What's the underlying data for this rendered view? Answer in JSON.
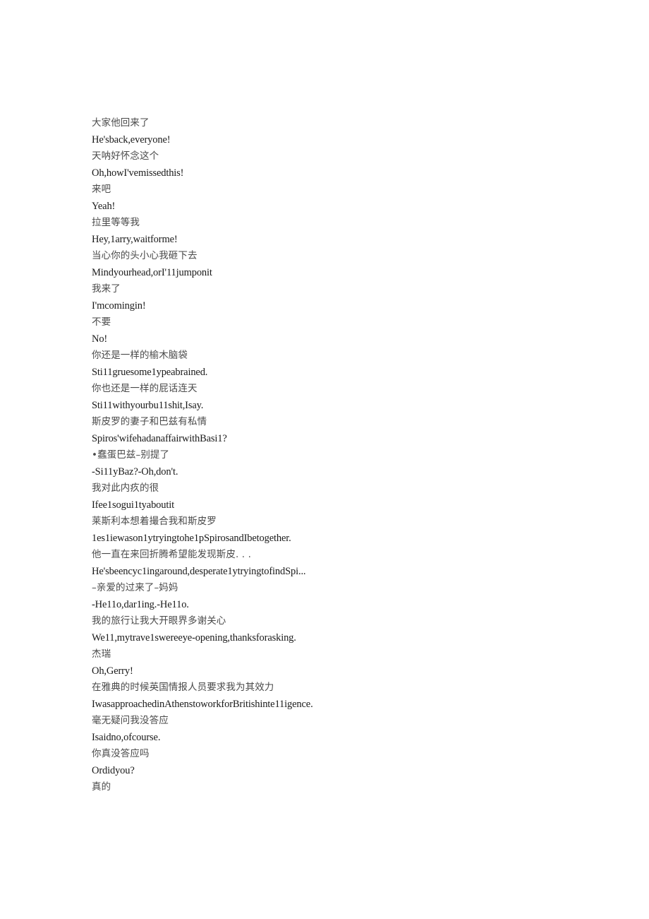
{
  "document": {
    "background_color": "#ffffff",
    "zh_text_color": "#4a4a4a",
    "en_text_color": "#1a1a1a",
    "lines": [
      {
        "lang": "zh",
        "text": "大家他回来了"
      },
      {
        "lang": "en",
        "text": "He'sback,everyone!"
      },
      {
        "lang": "zh",
        "text": "天呐好怀念这个"
      },
      {
        "lang": "en",
        "text": "Oh,howI'vemissedthis!"
      },
      {
        "lang": "zh",
        "text": "来吧"
      },
      {
        "lang": "en",
        "text": "Yeah!"
      },
      {
        "lang": "zh",
        "text": "拉里等等我"
      },
      {
        "lang": "en",
        "text": "Hey,1arry,waitforme!"
      },
      {
        "lang": "zh",
        "text": "当心你的头小心我砸下去"
      },
      {
        "lang": "en",
        "text": "Mindyourhead,orI'11jumponit"
      },
      {
        "lang": "zh",
        "text": "我来了"
      },
      {
        "lang": "en",
        "text": "I'mcomingin!"
      },
      {
        "lang": "zh",
        "text": "不要"
      },
      {
        "lang": "en",
        "text": "No!"
      },
      {
        "lang": "zh",
        "text": "你还是一样的榆木脑袋"
      },
      {
        "lang": "en",
        "text": "Sti11gruesome1ypeabrained."
      },
      {
        "lang": "zh",
        "text": "你也还是一样的屁话连天"
      },
      {
        "lang": "en",
        "text": "Sti11withyourbu11shit,Isay."
      },
      {
        "lang": "zh",
        "text": "斯皮罗的妻子和巴兹有私情"
      },
      {
        "lang": "en",
        "text": "Spiros'wifehadanaffairwithBasi1?"
      },
      {
        "lang": "zh",
        "text": "•蠢蛋巴兹–别提了"
      },
      {
        "lang": "en",
        "text": "-Si11yBaz?-Oh,don't."
      },
      {
        "lang": "zh",
        "text": "我对此内疚的很"
      },
      {
        "lang": "en",
        "text": "Ifee1sogui1tyaboutit"
      },
      {
        "lang": "zh",
        "text": "莱斯利本想着撮合我和斯皮罗"
      },
      {
        "lang": "en",
        "text": "1es1iewason1ytryingtohe1pSpirosandIbetogether."
      },
      {
        "lang": "zh",
        "text": "他一直在来回折腾希望能发现斯皮. . ."
      },
      {
        "lang": "en",
        "text": "He'sbeencyc1ingaround,desperate1ytryingtofindSpi..."
      },
      {
        "lang": "zh",
        "text": "–亲爱的过来了–妈妈"
      },
      {
        "lang": "en",
        "text": "-He11o,dar1ing.-He11o."
      },
      {
        "lang": "zh",
        "text": "我的旅行让我大开眼界多谢关心"
      },
      {
        "lang": "en",
        "text": "We11,mytrave1swereeye-opening,thanksforasking."
      },
      {
        "lang": "zh",
        "text": "杰瑞"
      },
      {
        "lang": "en",
        "text": "Oh,Gerry!"
      },
      {
        "lang": "zh",
        "text": "在雅典的时候英国情报人员要求我为其效力"
      },
      {
        "lang": "en",
        "text": "IwasapproachedinAthenstoworkforBritishinte11igence."
      },
      {
        "lang": "zh",
        "text": "毫无疑问我没答应"
      },
      {
        "lang": "en",
        "text": "Isaidno,ofcourse."
      },
      {
        "lang": "zh",
        "text": "你真没答应吗"
      },
      {
        "lang": "en",
        "text": "Ordidyou?"
      },
      {
        "lang": "zh",
        "text": "真的"
      }
    ]
  }
}
